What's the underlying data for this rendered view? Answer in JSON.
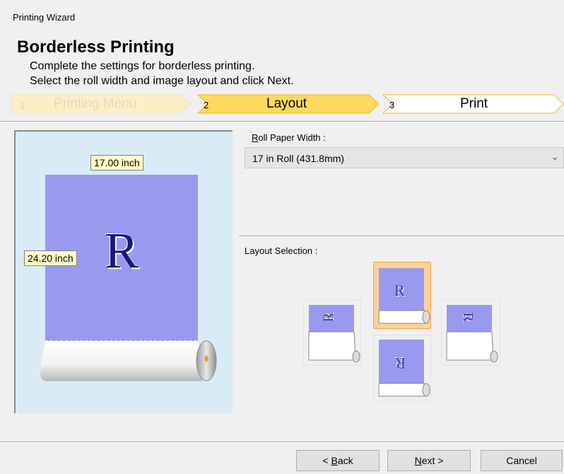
{
  "window_title": "Printing Wizard",
  "wizard": {
    "title": "Borderless Printing",
    "description_line1": "Complete the settings for borderless printing.",
    "description_line2": "Select the roll width and image layout and click Next."
  },
  "steps": [
    {
      "number": "1",
      "label": "Printing Menu",
      "state": "completed"
    },
    {
      "number": "2",
      "label": "Layout",
      "state": "current"
    },
    {
      "number": "3",
      "label": "Print",
      "state": "upcoming"
    }
  ],
  "preview": {
    "width_label": "17.00 inch",
    "height_label": "24.20 inch",
    "glyph": "R"
  },
  "roll_paper_width": {
    "label_accel": "R",
    "label_rest": "oll Paper Width :",
    "selected": "17 in Roll (431.8mm)"
  },
  "layout_selection": {
    "label": "Layout Selection :",
    "glyph": "R",
    "options": [
      {
        "id": "top",
        "selected": true
      },
      {
        "id": "left",
        "selected": false
      },
      {
        "id": "right",
        "selected": false
      },
      {
        "id": "bottom",
        "selected": false
      }
    ]
  },
  "buttons": {
    "back_prefix": "< ",
    "back_accel": "B",
    "back_rest": "ack",
    "next_accel": "N",
    "next_rest": "ext >",
    "cancel": "Cancel"
  },
  "colors": {
    "paper": "#9999f0",
    "current_step": "#fed95c",
    "completed_step": "#fdeec6",
    "preview_bg": "#d9ebf7",
    "selected_tile": "#fad39a"
  }
}
